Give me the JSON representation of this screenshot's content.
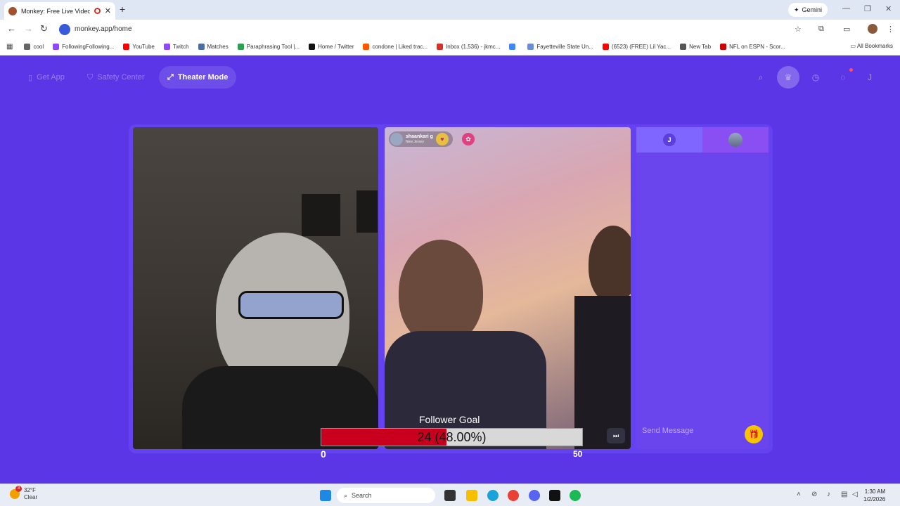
{
  "browser": {
    "tab_title": "Monkey: Free Live Video Cl",
    "new_tab_symbol": "+",
    "gemini_label": "Gemini",
    "url": "monkey.app/home",
    "bookmarks": [
      {
        "label": "cool",
        "color": "#666666"
      },
      {
        "label": "FollowingFollowing...",
        "color": "#9146ff"
      },
      {
        "label": "YouTube",
        "color": "#ff0000"
      },
      {
        "label": "Twitch",
        "color": "#9146ff"
      },
      {
        "label": "Matches",
        "color": "#4a6fa5"
      },
      {
        "label": "Paraphrasing Tool |...",
        "color": "#2e9e4f"
      },
      {
        "label": "Home / Twitter",
        "color": "#111111"
      },
      {
        "label": "condone | Liked trac...",
        "color": "#ff5500"
      },
      {
        "label": "Inbox (1,536) - jkmc...",
        "color": "#d93025"
      },
      {
        "label": "",
        "color": "#4285f4"
      },
      {
        "label": "Fayetteville State Un...",
        "color": "#6c8cd5"
      },
      {
        "label": "(6523) (FREE) Lil Yac...",
        "color": "#ff0000"
      },
      {
        "label": "New Tab",
        "color": "#555555"
      },
      {
        "label": "NFL on ESPN - Scor...",
        "color": "#cc0000"
      }
    ],
    "all_bookmarks": "All Bookmarks"
  },
  "app": {
    "nav": {
      "get_app": "Get App",
      "safety_center": "Safety Center",
      "theater_mode": "Theater Mode"
    },
    "remote_user": {
      "name": "shaankari g",
      "location": "New Jersey"
    },
    "chat": {
      "tab_user_initial": "J",
      "send_placeholder": "Send Message"
    },
    "profile_initial": "J"
  },
  "follower_goal": {
    "title": "Follower Goal",
    "current": 24,
    "percent_text": "24 (48.00%)",
    "progress_fraction": 0.48,
    "min": "0",
    "max": "50"
  },
  "taskbar": {
    "temperature": "32°F",
    "condition": "Clear",
    "weather_alert": "3",
    "search": "Search",
    "time": "1:30 AM",
    "date": "1/2/2026"
  }
}
